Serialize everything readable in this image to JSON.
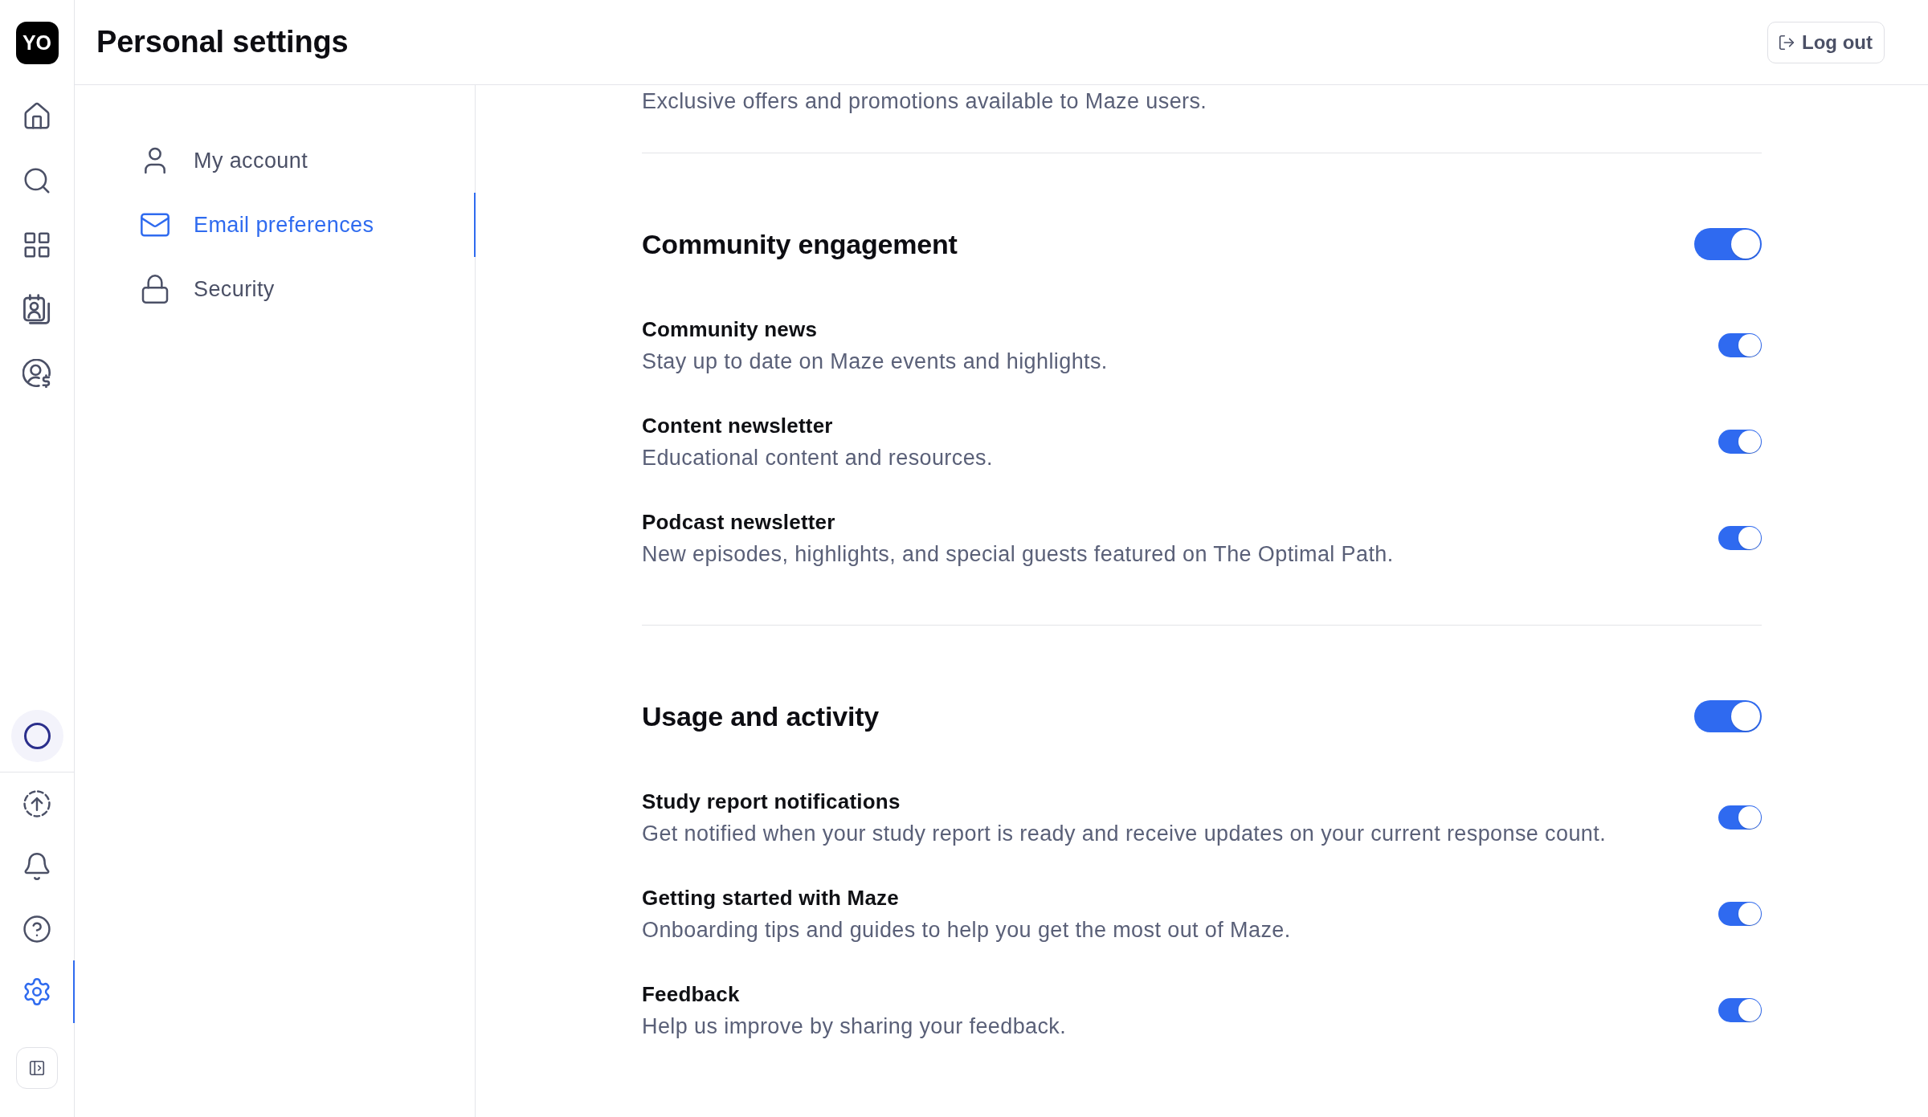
{
  "rail": {
    "avatar": "YO",
    "top_items": [
      {
        "selected": false
      },
      {
        "selected": false
      },
      {
        "selected": false
      },
      {
        "selected": false
      },
      {
        "selected": false
      }
    ],
    "bottom_items": [
      {
        "selected": false
      },
      {
        "selected": false
      },
      {
        "selected": false
      },
      {
        "selected": true
      }
    ]
  },
  "header": {
    "title": "Personal settings",
    "logout_button": "Log out"
  },
  "settings_nav": {
    "items": [
      {
        "label": "My account",
        "selected": false
      },
      {
        "label": "Email preferences",
        "selected": true
      },
      {
        "label": "Security",
        "selected": false
      }
    ]
  },
  "content": {
    "previous_description": "Exclusive offers and promotions available to Maze users.",
    "sections": [
      {
        "title": "Community engagement",
        "on": true,
        "items": [
          {
            "title": "Community news",
            "description": "Stay up to date on Maze events and highlights.",
            "on": true
          },
          {
            "title": "Content newsletter",
            "description": "Educational content and resources.",
            "on": true
          },
          {
            "title": "Podcast newsletter",
            "description": "New episodes, highlights, and special guests featured on The Optimal Path.",
            "on": true
          }
        ]
      },
      {
        "title": "Usage and activity",
        "on": true,
        "items": [
          {
            "title": "Study report notifications",
            "description": "Get notified when your study report is ready and receive updates on your current response count.",
            "on": true
          },
          {
            "title": "Getting started with Maze",
            "description": "Onboarding tips and guides to help you get the most out of Maze.",
            "on": true
          },
          {
            "title": "Feedback",
            "description": "Help us improve by sharing your feedback.",
            "on": true
          }
        ]
      }
    ]
  }
}
